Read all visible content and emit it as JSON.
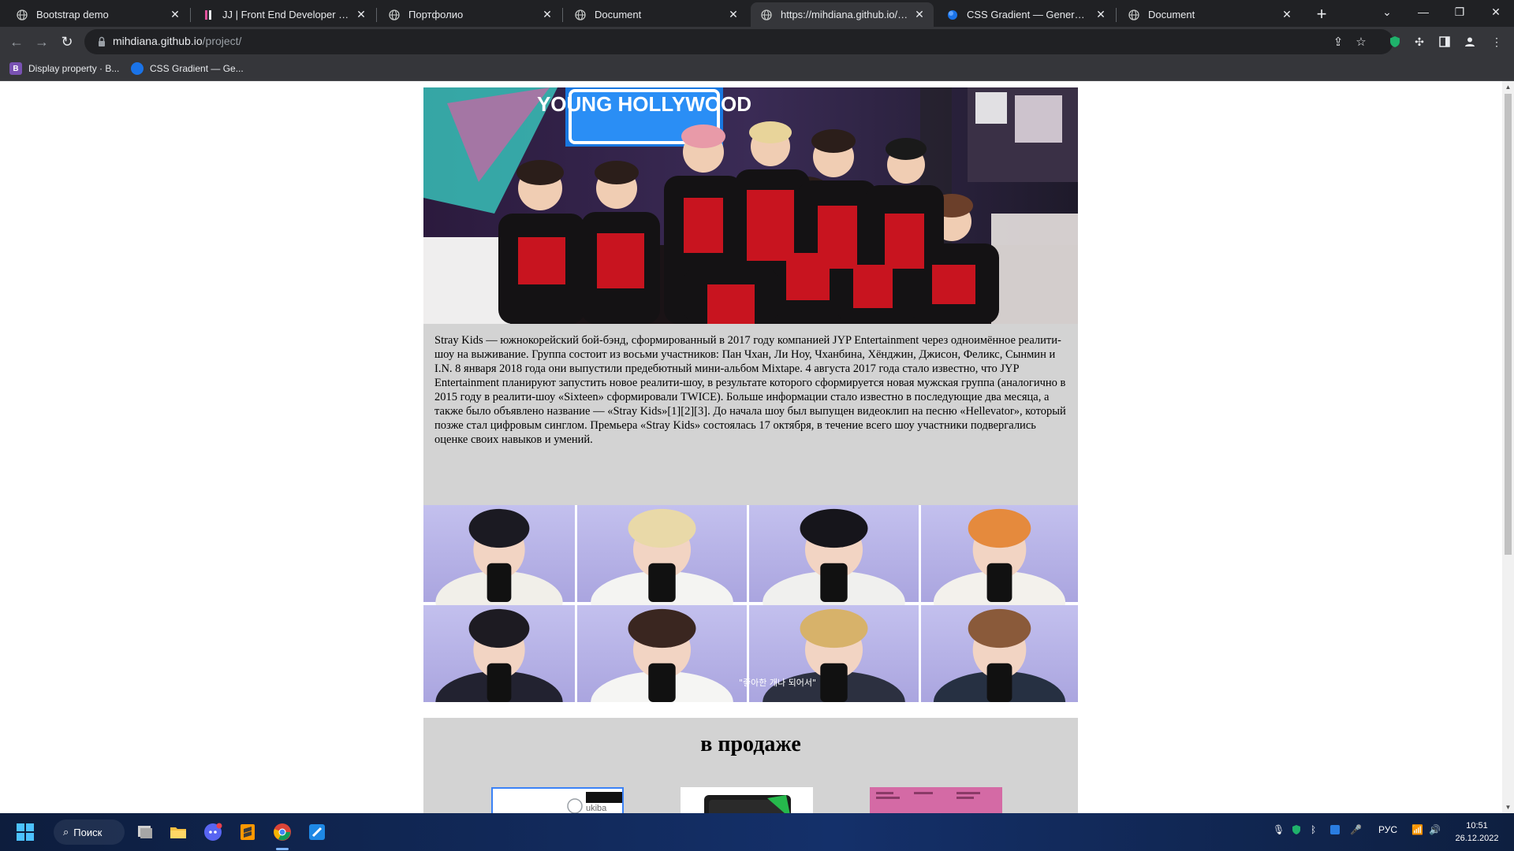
{
  "browser": {
    "tabs": [
      {
        "title": "Bootstrap demo",
        "active": false
      },
      {
        "title": "JJ | Front End Developer | WordPress",
        "active": false
      },
      {
        "title": "Портфолио",
        "active": false
      },
      {
        "title": "Document",
        "active": false
      },
      {
        "title": "https://mihdiana.github.io/project/",
        "active": true
      },
      {
        "title": "CSS Gradient — Generator, Maker",
        "active": false
      },
      {
        "title": "Document",
        "active": false
      }
    ],
    "new_tab": "+",
    "url_host": "mihdiana.github.io",
    "url_path": "/project/",
    "bookmarks": [
      {
        "label": "Display property · B...",
        "icon": "bootstrap-icon",
        "color": "#7952b3"
      },
      {
        "label": "CSS Gradient — Ge...",
        "icon": "css-gradient-icon",
        "color": "#1a73e8"
      }
    ]
  },
  "page": {
    "intro_text": "Stray Kids — южнокорейский бой-бэнд, сформированный в 2017 году компанией JYP Entertainment через одноимённое реалити-шоу на выживание. Группа состоит из восьми участников: Пан Чхан, Ли Ноу, Чханбина, Хёнджин, Джисон, Феликс, Сынмин и I.N. 8 января 2018 года они выпустили предебютный мини-альбом Mixtape. 4 августа 2017 года стало известно, что JYP Entertainment планируют запустить новое реалити-шоу, в результате которого сформируется новая мужская группа (аналогично в 2015 году в реалити-шоу «Sixteen» сформировали TWICE). Больше информации стало известно в последующие два месяца, а также было объявлено название — «Stray Kids»[1][2][3]. До начала шоу был выпущен видеоклип на песню «Hellevator», который позже стал цифровым синглом. Премьера «Stray Kids» состоялась 17 октября, в течение всего шоу участники подвергались оценке своих навыков и умений.",
    "hero_sign": "YOUNG HOLLYWOOD",
    "caption_in_grid": "\"좋아한 개나 되어서\"",
    "sale_heading": "в продаже",
    "product_label": "ukiba"
  },
  "taskbar": {
    "search_label": "Поиск",
    "lang": "РУС",
    "time": "10:51",
    "date": "26.12.2022"
  },
  "colors": {
    "chrome_dark": "#202124",
    "chrome_toolbar": "#35363a",
    "page_gray": "#d3d3d3",
    "grid_bg": "#b9b6e6"
  }
}
